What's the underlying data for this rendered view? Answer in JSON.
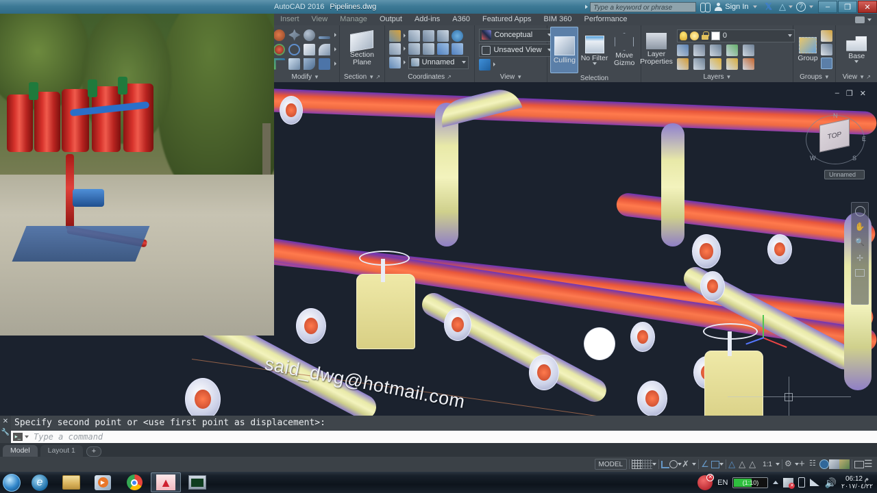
{
  "titlebar": {
    "app_name": "AutoCAD 2016",
    "document": "Pipelines.dwg",
    "search_placeholder": "Type a keyword or phrase",
    "sign_in": "Sign In",
    "help_glyph": "?",
    "minimize": "–",
    "restore": "❐",
    "close": "✕"
  },
  "ribbon": {
    "tabs": [
      {
        "label": "Insert",
        "state": "dim"
      },
      {
        "label": "View",
        "state": "dim"
      },
      {
        "label": "Manage",
        "state": "dim"
      },
      {
        "label": "Output",
        "state": "normal"
      },
      {
        "label": "Add-ins",
        "state": "normal"
      },
      {
        "label": "A360",
        "state": "normal"
      },
      {
        "label": "Featured Apps",
        "state": "normal"
      },
      {
        "label": "BIM 360",
        "state": "normal"
      },
      {
        "label": "Performance",
        "state": "normal"
      }
    ],
    "panels": {
      "modify": {
        "title": "Modify"
      },
      "section": {
        "title": "Section",
        "button_line1": "Section",
        "button_line2": "Plane"
      },
      "coordinates": {
        "title": "Coordinates",
        "ucs_combo": "Unnamed"
      },
      "view": {
        "title": "View",
        "visual_style": "Conceptual",
        "named_view": "Unsaved View"
      },
      "selection": {
        "title": "Selection",
        "culling": "Culling",
        "no_filter": "No Filter",
        "move_gizmo_l1": "Move",
        "move_gizmo_l2": "Gizmo"
      },
      "layers": {
        "title": "Layers",
        "layer_properties_l1": "Layer",
        "layer_properties_l2": "Properties",
        "current_layer": "0"
      },
      "groups": {
        "title": "Groups",
        "group_label": "Group"
      },
      "viewpanel": {
        "title": "View",
        "base_label": "Base"
      }
    }
  },
  "canvas": {
    "watermark": "said_dwg@hotmail.com",
    "viewcube_face": "TOP",
    "viewcube_dirs": [
      "N",
      "E",
      "S",
      "W"
    ],
    "view_name": "Unnamed",
    "background_color": "#1b222e",
    "pipe_orange": "#ef6a42",
    "pipe_yellow": "#eeeeb4",
    "vp_controls": [
      "–",
      "❐",
      "✕"
    ]
  },
  "command": {
    "history": "Specify second point or <use first point as displacement>:",
    "placeholder": "Type a command",
    "prompt_glyph": "▸_"
  },
  "tabs": {
    "model": "Model",
    "layout1": "Layout 1",
    "add": "+"
  },
  "statusbar": {
    "model_label": "MODEL",
    "scale": "1:1",
    "items": [
      "grid-display",
      "snap-mode",
      "ortho-mode",
      "polar-tracking",
      "isometric-drafting",
      "object-snap-tracking",
      "object-snap",
      "3d-object-snap",
      "dynamic-ucs",
      "annotation-scale",
      "workspace-switching",
      "hardware-acceleration",
      "isolate-objects",
      "clean-screen",
      "customization"
    ]
  },
  "taskbar": {
    "apps": [
      "start-orb",
      "internet-explorer",
      "windows-explorer",
      "windows-media-player",
      "google-chrome",
      "autocad",
      "remote-desktop"
    ],
    "language": "EN",
    "battery": "(1:10)",
    "time": "06:12 م",
    "date": "٢٠١٧/٠٤/٢٢"
  }
}
